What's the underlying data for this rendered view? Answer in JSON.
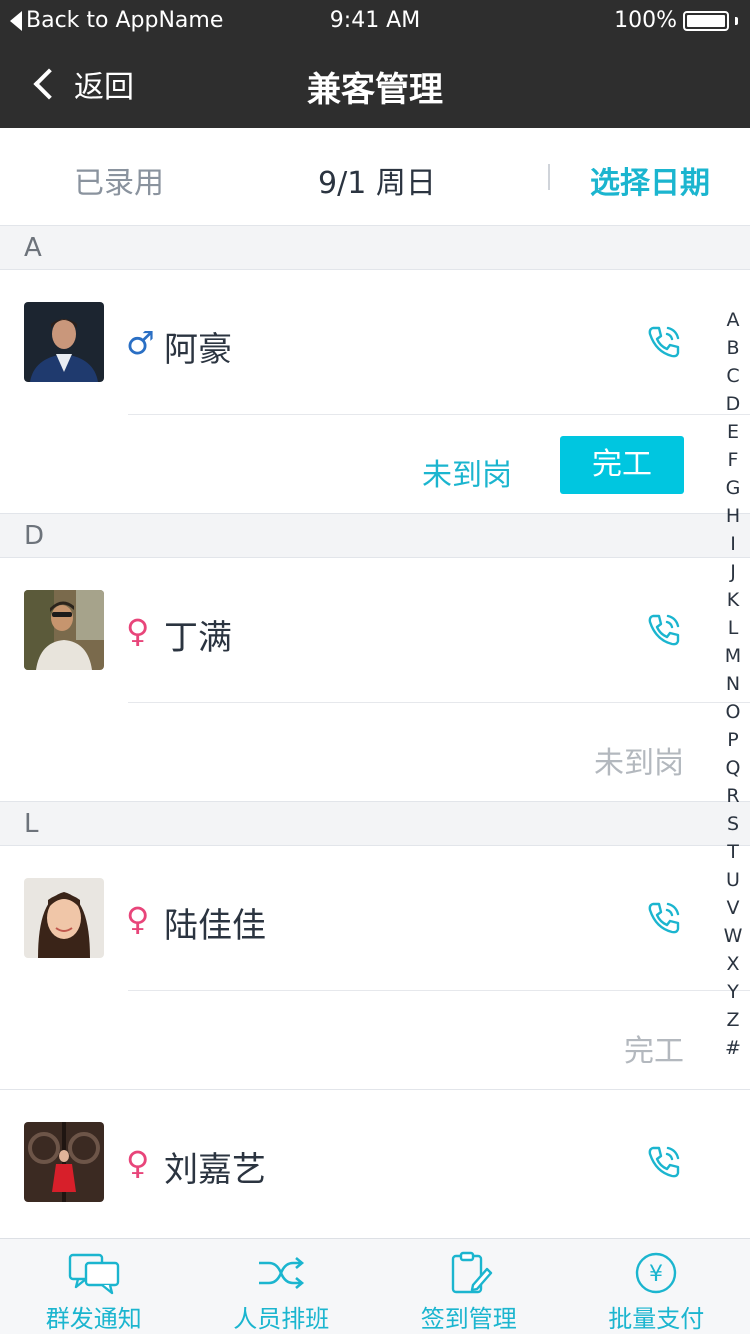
{
  "status_bar": {
    "back_app": "Back to AppName",
    "time": "9:41 AM",
    "battery": "100%"
  },
  "nav": {
    "back_label": "返回",
    "title": "兼客管理"
  },
  "filter": {
    "left": "已录用",
    "date": "9/1 周日",
    "pick": "选择日期"
  },
  "sections": [
    {
      "letter": "A"
    },
    {
      "letter": "D"
    },
    {
      "letter": "L"
    }
  ],
  "people": [
    {
      "gender": "♂",
      "name": "阿豪",
      "action_link": "未到岗",
      "action_button": "完工"
    },
    {
      "gender": "♀",
      "name": "丁满",
      "status": "未到岗"
    },
    {
      "gender": "♀",
      "name": "陆佳佳",
      "status": "完工"
    },
    {
      "gender": "♀",
      "name": "刘嘉艺"
    }
  ],
  "index_letters": [
    "A",
    "B",
    "C",
    "D",
    "E",
    "F",
    "G",
    "H",
    "I",
    "J",
    "K",
    "L",
    "M",
    "N",
    "O",
    "P",
    "Q",
    "R",
    "S",
    "T",
    "U",
    "V",
    "W",
    "X",
    "Y",
    "Z",
    "#"
  ],
  "tabs": [
    {
      "label": "群发通知",
      "icon": "chat-bubbles-icon"
    },
    {
      "label": "人员排班",
      "icon": "shuffle-icon"
    },
    {
      "label": "签到管理",
      "icon": "clipboard-edit-icon"
    },
    {
      "label": "批量支付",
      "icon": "yen-circle-icon"
    }
  ],
  "colors": {
    "accent": "#1bb5cf",
    "button": "#00c6e0",
    "male": "#2a6fc4",
    "female": "#e8457a",
    "nav_bg": "#2e2e2e"
  }
}
